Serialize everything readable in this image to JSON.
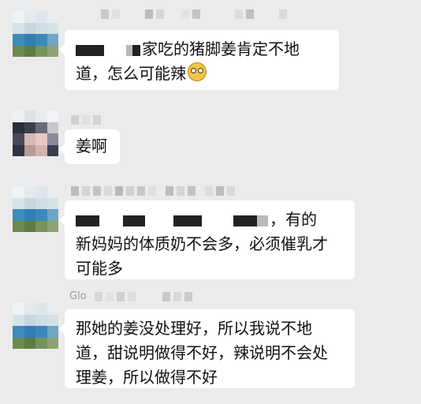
{
  "messages": [
    {
      "line1": "家吃的猪脚姜肯定不地",
      "line2": "道，怎么可能辣"
    },
    {
      "line1": "姜啊"
    },
    {
      "line1": "，有的",
      "line2": "新妈妈的体质奶不会多，必须催乳才",
      "line3": "可能多"
    },
    {
      "sender_fragment": "Glo",
      "line1": "那她的姜没处理好，所以我说不地",
      "line2": "道，甜说明做得不好，辣说明不会处",
      "line3": "理姜，所以做得不好"
    }
  ],
  "colors": {
    "background": "#ebebeb",
    "bubble": "#ffffff",
    "text": "#111111"
  },
  "icons": {
    "emoji": "dizzy-face-emoji-icon"
  }
}
